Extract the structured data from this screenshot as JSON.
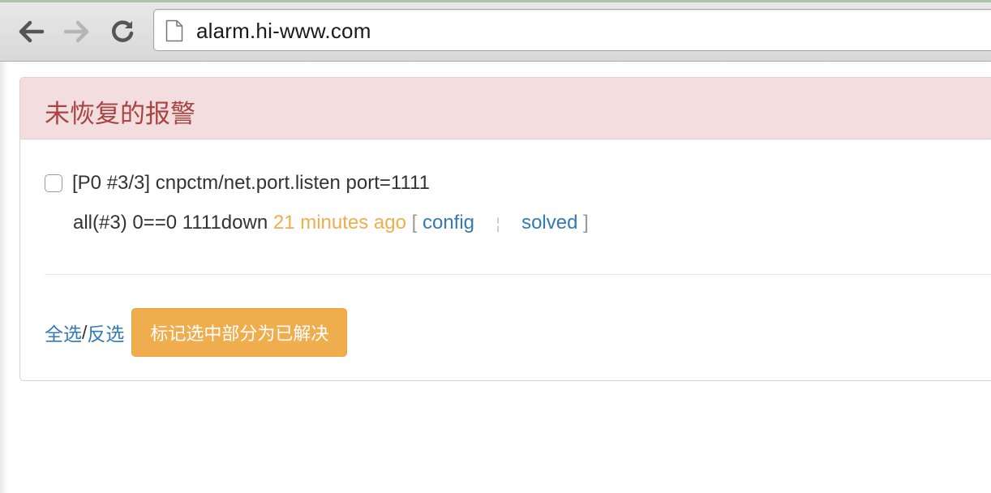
{
  "browser": {
    "url": "alarm.hi-www.com",
    "back_icon": "arrow-left-icon",
    "forward_icon": "arrow-right-icon",
    "reload_icon": "reload-icon",
    "page_icon": "document-icon"
  },
  "panel": {
    "title": "未恢复的报警",
    "colors": {
      "heading_bg": "#f2dede",
      "heading_text": "#a94442",
      "link": "#337ab7",
      "warning": "#f0ad4e"
    }
  },
  "alarm": {
    "summary": "[P0 #3/3] cnpctm/net.port.listen port=1111",
    "detail": "all(#3) 0==0 1111down",
    "time_ago": "21 minutes ago",
    "bracket_open": "[",
    "config_label": "config",
    "separator": "¦",
    "solved_label": "solved",
    "bracket_close": "]",
    "checked": false
  },
  "actions": {
    "select_all": "全选",
    "slash": "/",
    "invert_selection": "反选",
    "mark_solved_button": "标记选中部分为已解决"
  }
}
